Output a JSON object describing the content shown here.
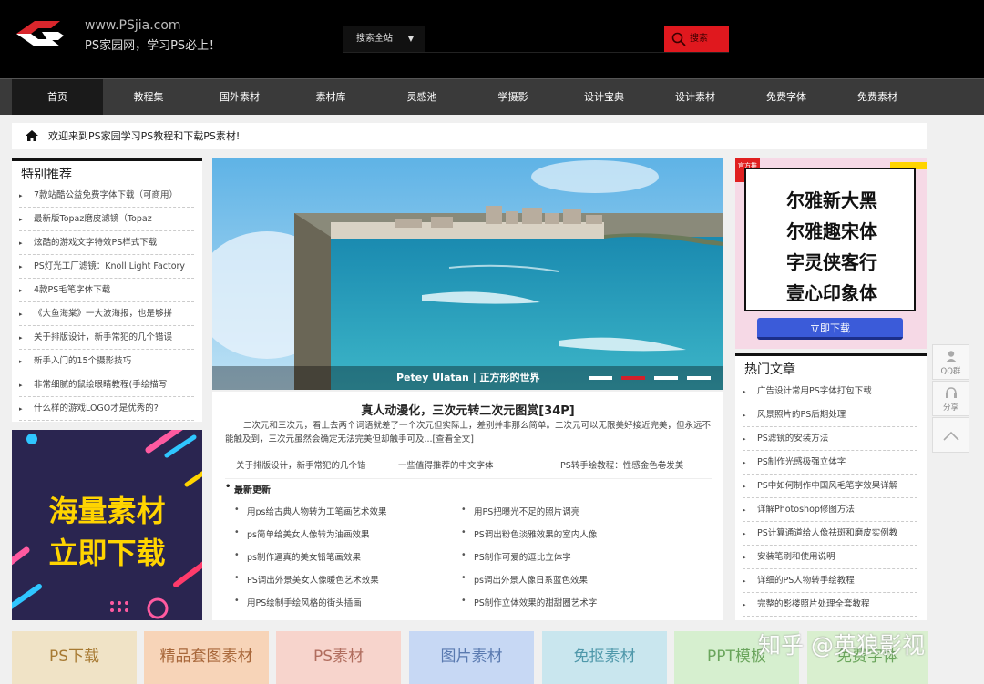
{
  "header": {
    "site_url": "www.PSjia.com",
    "slogan": "PS家园网，学习PS必上！",
    "search": {
      "scope": "搜索全站",
      "placeholder": "",
      "button": "搜索"
    }
  },
  "nav": [
    "首页",
    "教程集",
    "国外素材",
    "素材库",
    "灵感池",
    "学摄影",
    "设计宝典",
    "设计素材",
    "免费字体",
    "免费素材"
  ],
  "notice": "欢迎来到PS家园学习PS教程和下载PS素材!",
  "featured": {
    "title": "特别推荐",
    "items": [
      "7款站酷公益免费字体下载（可商用）",
      "最新版Topaz磨皮滤镜（Topaz",
      "炫酷的游戏文字特效PS样式下载",
      "PS灯光工厂滤镜：Knoll Light Factory",
      "4款PS毛笔字体下载",
      "《大鱼海棠》一大波海报，也是够拼",
      "关于排版设计，新手常犯的几个错误",
      "新手入门的15个摄影技巧",
      "非常细腻的鼠绘眼睛教程(手绘描写",
      "什么样的游戏LOGO才是优秀的?"
    ]
  },
  "left_ad": {
    "line1": "海量素材",
    "line2": "立即下载"
  },
  "banner": {
    "caption": "Petey Ulatan | 正方形的世界",
    "dots": 4,
    "active_dot": 2
  },
  "article": {
    "title": "真人动漫化，三次元转二次元图赏[34P]",
    "summary": "二次元和三次元，看上去两个词语就差了一个次元但实际上，差别并非那么简单。二次元可以无限美好接近完美，但永远不能触及到，三次元虽然会确定无法完美但却触手可及...[查看全文]",
    "related": [
      "关于排版设计，新手常犯的几个错",
      "一些值得推荐的中文字体",
      "PS转手绘教程：性感金色卷发美"
    ],
    "latest_title": "最新更新",
    "latest_left": [
      "用ps给古典人物转为工笔画艺术效果",
      "ps简单给美女人像转为油画效果",
      "ps制作逼真的美女铅笔画效果",
      "PS调出外景美女人像暖色艺术效果",
      "用PS绘制手绘风格的街头插画"
    ],
    "latest_right": [
      "用PS把曝光不足的照片调亮",
      "PS调出粉色淡雅效果的室内人像",
      "PS制作可爱的逗比立体字",
      "ps调出外景人像日系蓝色效果",
      "PS制作立体效果的甜甜圈艺术字"
    ]
  },
  "right_ad": {
    "tag": "官方推荐",
    "fonts": [
      "尔雅新大黑",
      "尔雅趣宋体",
      "字灵侠客行",
      "壹心印象体"
    ],
    "button": "立即下载"
  },
  "hot": {
    "title": "热门文章",
    "items": [
      "广告设计常用PS字体打包下载",
      "风景照片的PS后期处理",
      "PS滤镜的安装方法",
      "PS制作光感极强立体字",
      "PS中如何制作中国风毛笔字效果详解",
      "详解Photoshop修图方法",
      "PS计算通道给人像祛斑和磨皮实例教",
      "安装笔刷和使用说明",
      "详细的PS人物转手绘教程",
      "完整的影楼照片处理全套教程"
    ]
  },
  "float_tools": [
    {
      "label": "QQ群",
      "icon": "user-icon"
    },
    {
      "label": "分享",
      "icon": "headset-icon"
    },
    {
      "label": "",
      "icon": "arrow-up-icon"
    }
  ],
  "categories": [
    {
      "label": "PS下载",
      "bg": "#f0e3c6",
      "fg": "#a77a33"
    },
    {
      "label": "精品套图素材",
      "bg": "#f7d4b8",
      "fg": "#a8673a"
    },
    {
      "label": "PS素材",
      "bg": "#f7d4cc",
      "fg": "#b06d5e"
    },
    {
      "label": "图片素材",
      "bg": "#c7d8f4",
      "fg": "#5a7ab0"
    },
    {
      "label": "免抠素材",
      "bg": "#c9e6ee",
      "fg": "#4f98aa"
    },
    {
      "label": "PPT模板",
      "bg": "#d6efcf",
      "fg": "#6aa55c"
    },
    {
      "label": "免费字体",
      "bg": "#d9efcf",
      "fg": "#6aa55c"
    }
  ],
  "watermark": "知乎 @英狼影视"
}
